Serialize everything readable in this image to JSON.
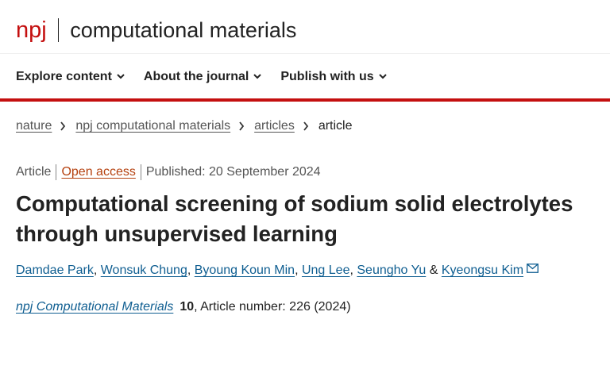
{
  "header": {
    "brand_short": "npj",
    "brand_name": "computational materials"
  },
  "nav": {
    "items": [
      {
        "label": "Explore content"
      },
      {
        "label": "About the journal"
      },
      {
        "label": "Publish with us"
      }
    ]
  },
  "colors": {
    "brand_red": "#c40f0f",
    "link_blue": "#0f5e91",
    "open_access_orange": "#b5410f"
  },
  "breadcrumb": {
    "items": [
      "nature",
      "npj computational materials",
      "articles"
    ],
    "current": "article"
  },
  "article": {
    "type": "Article",
    "access": "Open access",
    "published": "Published: 20 September 2024",
    "title": "Computational screening of sodium solid electrolytes through unsupervised learning",
    "authors": [
      "Damdae Park",
      "Wonsuk Chung",
      "Byoung Koun Min",
      "Ung Lee",
      "Seungho Yu",
      "Kyeongsu Kim"
    ],
    "author_sep": ",",
    "author_last_sep": "&",
    "corresponding_icon": "mail-icon",
    "citation": {
      "journal": "npj Computational Materials",
      "volume": "10",
      "rest": ", Article number: 226 (2024)"
    }
  }
}
